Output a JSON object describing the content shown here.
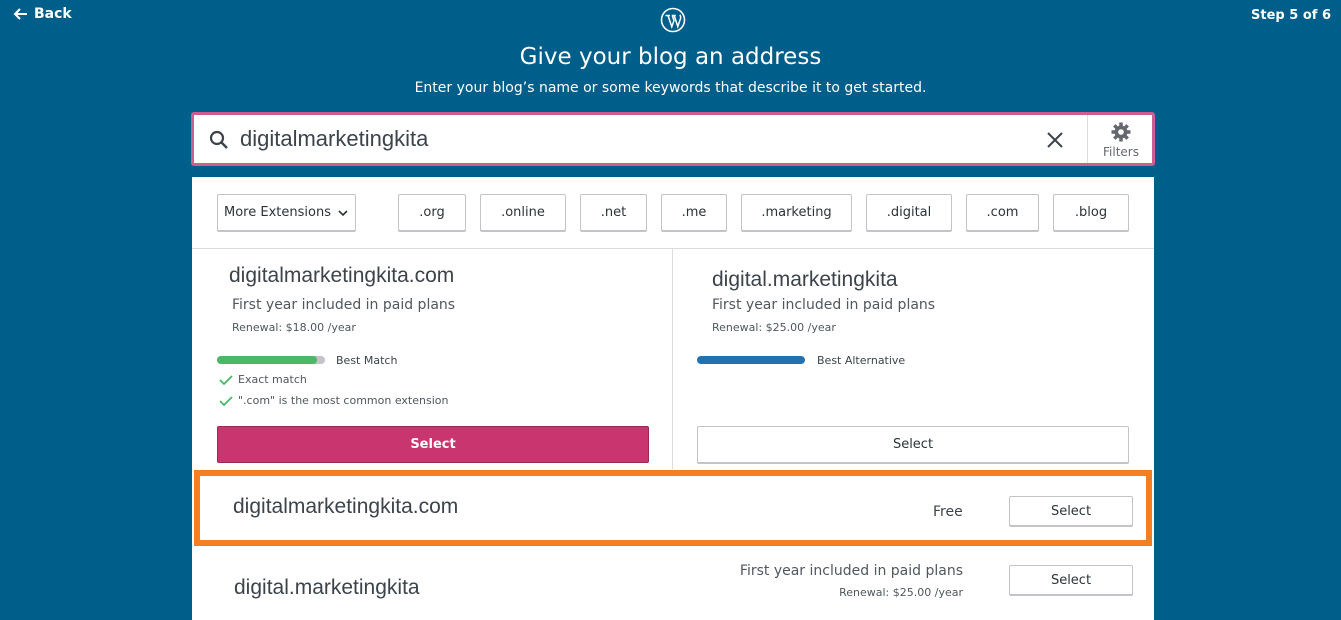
{
  "header": {
    "back_label": "Back",
    "step_label": "Step 5 of 6"
  },
  "hero": {
    "title": "Give your blog an address",
    "subtitle": "Enter your blog’s name or some keywords that describe it to get started."
  },
  "search": {
    "value": "digitalmarketingkita",
    "filters_label": "Filters"
  },
  "extensions": {
    "more_label": "More Extensions",
    "items": [
      ".org",
      ".online",
      ".net",
      ".me",
      ".marketing",
      ".digital",
      ".com",
      ".blog"
    ]
  },
  "featured": [
    {
      "domain": "digitalmarketingkita.com",
      "price": "First year included in paid plans",
      "renewal": "Renewal: $18.00 /year",
      "badge": "Best Match",
      "checks": [
        "Exact match",
        "\".com\" is the most common extension"
      ],
      "button": "Select"
    },
    {
      "domain": "digital.marketingkita",
      "price": "First year included in paid plans",
      "renewal": "Renewal: $25.00 /year",
      "badge": "Best Alternative",
      "button": "Select"
    }
  ],
  "results": [
    {
      "domain": "digitalmarketingkita.com",
      "price": "Free",
      "button": "Select"
    },
    {
      "domain": "digital.marketingkita",
      "price": "First year included in paid plans",
      "renewal": "Renewal: $25.00 /year",
      "button": "Select"
    }
  ],
  "colors": {
    "background": "#005e8b",
    "accent_pink": "#c9356e",
    "best_match_green": "#4ab866",
    "best_alternative_blue": "#2271b1",
    "highlight_orange": "#f47f20"
  },
  "icons": [
    "arrow-left-icon",
    "wordpress-logo",
    "search-icon",
    "close-icon",
    "gear-icon",
    "chevron-down-icon",
    "checkmark-icon"
  ]
}
